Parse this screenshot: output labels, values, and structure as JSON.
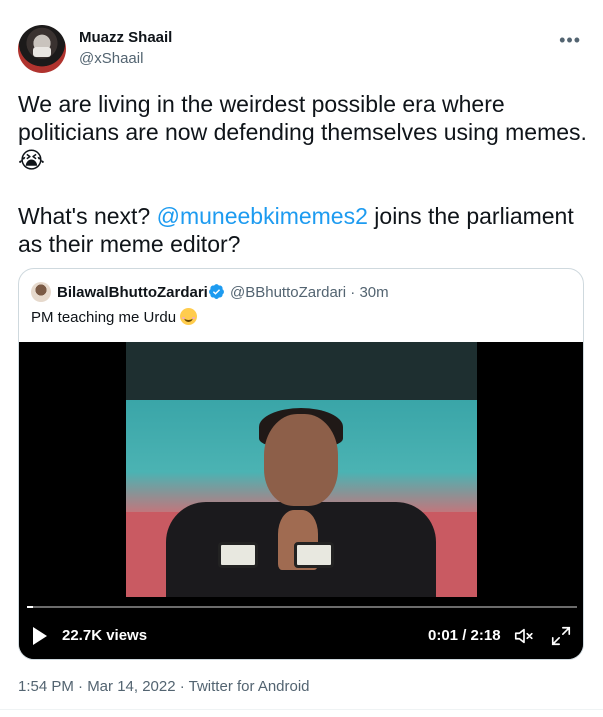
{
  "author": {
    "display_name": "Muazz Shaail",
    "handle": "@xShaail"
  },
  "more_icon": "more-horizontal-icon",
  "tweet": {
    "line1": "We are living in the weirdest possible era where politicians are now defending themselves using memes. 😭",
    "line2_prefix": "What's next? ",
    "mention": "@muneebkimemes2",
    "line2_suffix": " joins the parliament as their meme editor?"
  },
  "quoted": {
    "display_name": "BilawalBhuttoZardari",
    "handle_time": "@BBhuttoZardari · 30m",
    "text": "PM teaching me Urdu",
    "video": {
      "views": "22.7K views",
      "time": "0:01 / 2:18",
      "progress": 0.01
    }
  },
  "meta": "1:54 PM · Mar 14, 2022 · Twitter for Android",
  "colors": {
    "accent": "#1d9bf0",
    "secondary_text": "#536471",
    "primary_text": "#0f1419"
  }
}
